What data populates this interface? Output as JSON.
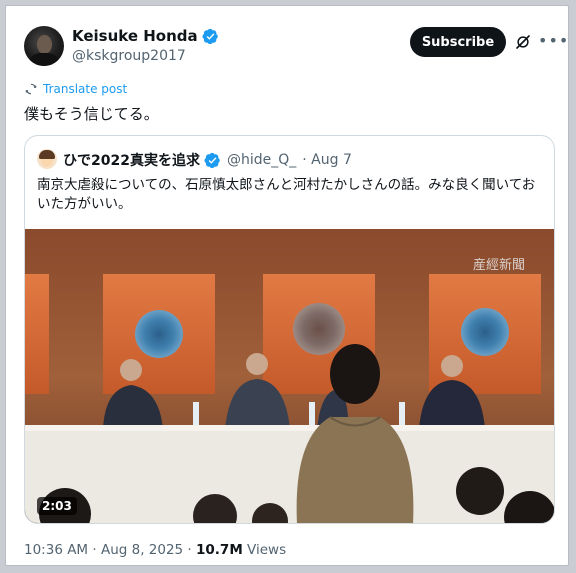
{
  "post": {
    "author_name": "Keisuke Honda",
    "author_handle": "@kskgroup2017",
    "subscribe_label": "Subscribe",
    "translate_label": "Translate post",
    "text": "僕もそう信じてる。",
    "timestamp": "10:36 AM · Aug 8, 2025",
    "separator": " · ",
    "views_count": "10.7M",
    "views_label": " Views"
  },
  "quoted": {
    "author_name": "ひで2022真実を追求",
    "author_handle": "@hide_Q_",
    "date": "· Aug 7",
    "text": "南京大虐殺についての、石原慎太郎さんと河村たかしさんの話。みな良く聞いておいた方がいい。",
    "video": {
      "duration": "2:03",
      "watermark": "産經新聞"
    }
  },
  "colors": {
    "accent": "#1d9bf0",
    "button_bg": "#0f1419",
    "secondary_text": "#536471"
  },
  "icons": {
    "verified": "verified-badge-icon",
    "grok": "grok-icon",
    "more": "more-icon",
    "translate": "translate-icon"
  }
}
